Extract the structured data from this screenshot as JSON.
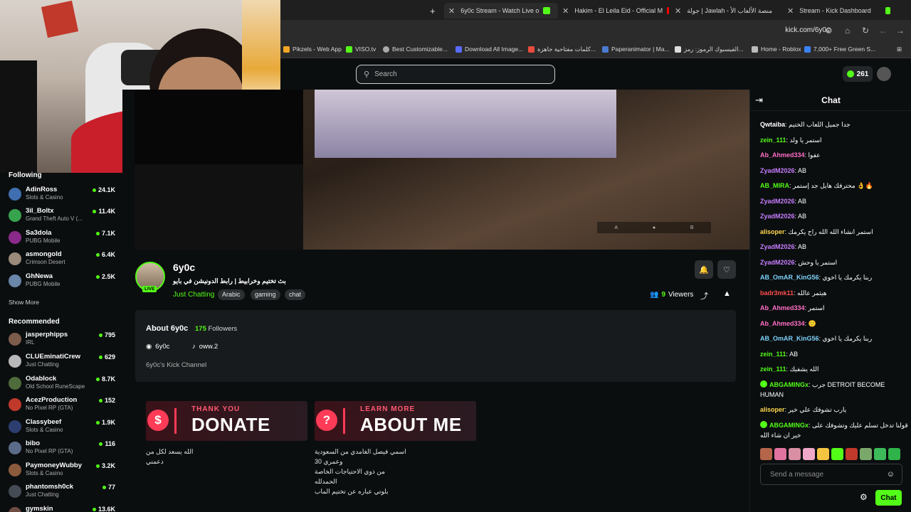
{
  "browser": {
    "tabs": [
      {
        "label": "6y0c Stream - Watch Live o",
        "active": true
      },
      {
        "label": "Hakim - El Leila Eid - Official M"
      },
      {
        "label": "جولة | Jawlah - منصة الألعاب الأ"
      },
      {
        "label": "Stream - Kick Dashboard"
      }
    ],
    "url": "kick.com/6y0c",
    "bookmarks": [
      "Pikzels - Web App",
      "VISO.tv",
      "Best Customizable...",
      "Download All Image...",
      "كلمات مفتاحية جاهزة...",
      "Paperanimator | Ma...",
      "الفيسبوك الرموز: رمز...",
      "Home - Roblox",
      "7,000+ Free Green S..."
    ]
  },
  "topnav": {
    "search_placeholder": "Search",
    "points": "261"
  },
  "sidebar": {
    "following_title": "Following",
    "following": [
      {
        "name": "AdinRoss",
        "game": "Slots & Casino",
        "viewers": "24.1K",
        "color": "#3f6fb0"
      },
      {
        "name": "3il_Boltx",
        "game": "Grand Theft Auto V (...",
        "viewers": "11.4K",
        "color": "#37a34d"
      },
      {
        "name": "Sa3dola",
        "game": "PUBG Mobile",
        "viewers": "7.1K",
        "color": "#8a2a8a"
      },
      {
        "name": "asmongold",
        "game": "Crimson Desert",
        "viewers": "6.4K",
        "color": "#9a8a7a"
      },
      {
        "name": "GhNewa",
        "game": "PUBG Mobile",
        "viewers": "2.5K",
        "color": "#6a86a8"
      }
    ],
    "show_more": "Show More",
    "recommended_title": "Recommended",
    "recommended": [
      {
        "name": "jasperphipps",
        "game": "IRL",
        "viewers": "795",
        "color": "#7d5c4b"
      },
      {
        "name": "CLUEminatiCrew",
        "game": "Just Chatting",
        "viewers": "629",
        "color": "#b8b8b8"
      },
      {
        "name": "Odablock",
        "game": "Old School RuneScape",
        "viewers": "8.7K",
        "color": "#4f6b3b"
      },
      {
        "name": "AcezProduction",
        "game": "No Pixel RP (GTA)",
        "viewers": "152",
        "color": "#c0392b"
      },
      {
        "name": "Classybeef",
        "game": "Slots & Casino",
        "viewers": "1.9K",
        "color": "#2c3e70"
      },
      {
        "name": "bibo",
        "game": "No Pixel RP (GTA)",
        "viewers": "116",
        "color": "#5b6c8a"
      },
      {
        "name": "PaymoneyWubby",
        "game": "Slots & Casino",
        "viewers": "3.2K",
        "color": "#8c5a3c"
      },
      {
        "name": "phantomsh0ck",
        "game": "Just Chatting",
        "viewers": "77",
        "color": "#444b55"
      },
      {
        "name": "gymskin",
        "game": "",
        "viewers": "13.6K",
        "color": "#6d4c41"
      }
    ]
  },
  "stream": {
    "streamer": "6y0c",
    "live_badge": "LIVE",
    "title": "بث تختيم وخرابيط | رابط الدونيشن في بايو",
    "category": "Just Chatting",
    "tags": [
      "Arabic",
      "gaming",
      "chat"
    ],
    "viewers_count": "9",
    "viewers_label": "Viewers"
  },
  "about": {
    "title": "About 6y0c",
    "followers_count": "175",
    "followers_label": "Followers",
    "discord": "6y0c",
    "tiktok": "oww.2",
    "description": "6y0c's Kick Channel"
  },
  "panels": [
    {
      "small": "THANK YOU",
      "big": "DONATE",
      "icon": "$",
      "desc": "الله يسعد لكل من دعمني"
    },
    {
      "small": "LEARN MORE",
      "big": "ABOUT ME",
      "icon": "?",
      "desc_lines": [
        "اسمي فيصل الغامدي من السعودية",
        "وعمري 30",
        "من ذوي الاحتياجات الخاصة الحمدلله",
        "بلوتي عباره عن تختيم الماب"
      ]
    }
  ],
  "chat": {
    "title": "Chat",
    "messages": [
      {
        "user": "Qwtaiba",
        "color": "#ffffff",
        "text": "جدا جميل اللعاب الختيم"
      },
      {
        "user": "zein_111",
        "color": "#53fc18",
        "text": "استمر يا ولد"
      },
      {
        "user": "Ab_Ahmed334",
        "color": "#ff6ec7",
        "text": "عفوا"
      },
      {
        "user": "ZyadM2026",
        "color": "#c77dff",
        "text": "AB"
      },
      {
        "user": "AB_MIRA",
        "color": "#53fc18",
        "text": "محترفك هايل جد إستمر 👌🔥"
      },
      {
        "user": "ZyadM2026",
        "color": "#c77dff",
        "text": "AB"
      },
      {
        "user": "ZyadM2026",
        "color": "#c77dff",
        "text": "AB"
      },
      {
        "user": "alisoper",
        "color": "#ffd84d",
        "text": "استمر انشاء الله الله راح يكرمك"
      },
      {
        "user": "ZyadM2026",
        "color": "#c77dff",
        "text": "AB"
      },
      {
        "user": "ZyadM2026",
        "color": "#c77dff",
        "text": "استمر يا وحش"
      },
      {
        "user": "AB_OmAR_KinG56",
        "color": "#7dd3fc",
        "text": "ربنا يكرمك يا اخوي"
      },
      {
        "user": "badr3mk11",
        "color": "#ff4d4d",
        "text": "هيثمر عالله"
      },
      {
        "user": "Ab_Ahmed334",
        "color": "#ff6ec7",
        "text": "استمر"
      },
      {
        "user": "Ab_Ahmed334",
        "color": "#ff6ec7",
        "text": "🙂"
      },
      {
        "user": "AB_OmAR_KinG56",
        "color": "#7dd3fc",
        "text": "ربنا يكرمك يا اخوي"
      },
      {
        "user": "zein_111",
        "color": "#53fc18",
        "text": "AB"
      },
      {
        "user": "zein_111",
        "color": "#53fc18",
        "text": "الله يشفيك"
      },
      {
        "user": "ABGAMINGx",
        "color": "#53fc18",
        "text": "جرب DETROIT BECOME HUMAN",
        "badge": true
      },
      {
        "user": "alisoper",
        "color": "#ffd84d",
        "text": "يارب تشوفك علي خير"
      },
      {
        "user": "ABGAMINGx",
        "color": "#53fc18",
        "text": "قولنا تدخل تسلم عليك وتشوفك على خير ان شاء الله",
        "badge": true
      }
    ],
    "input_placeholder": "Send a message",
    "send_label": "Chat"
  }
}
